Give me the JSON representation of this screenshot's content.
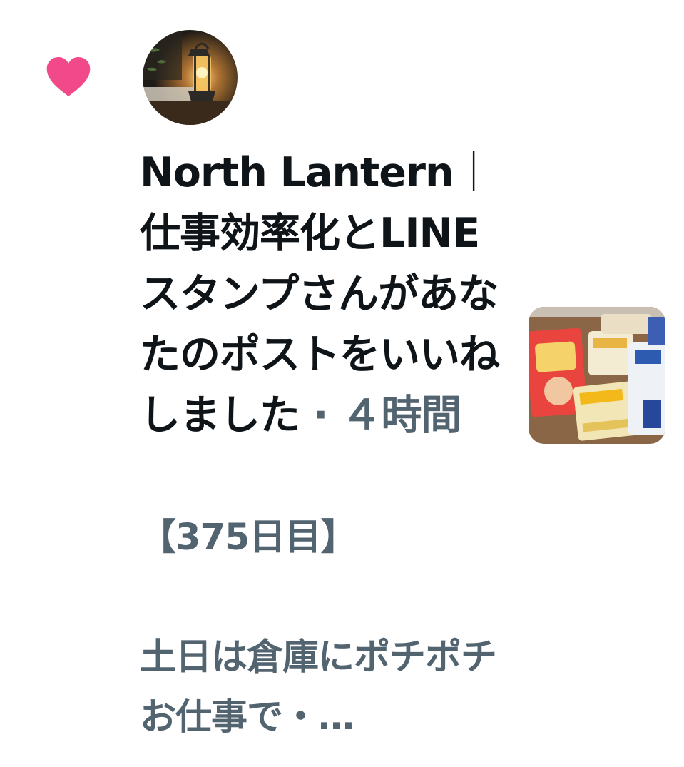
{
  "notification": {
    "actor_name": "North Lantern",
    "actor_separator": "｜",
    "actor_tagline": "仕事効率化とLINE スタンプ",
    "action_text": "さんがあなたのポストをいいねしました",
    "dot": "·",
    "time_ago": "４時間",
    "post_preview_line1": "【375日目】",
    "post_preview_line2": "土日は倉庫にポチポチお仕事で・…",
    "icon": "heart-icon",
    "heart_color": "#f2498b"
  }
}
